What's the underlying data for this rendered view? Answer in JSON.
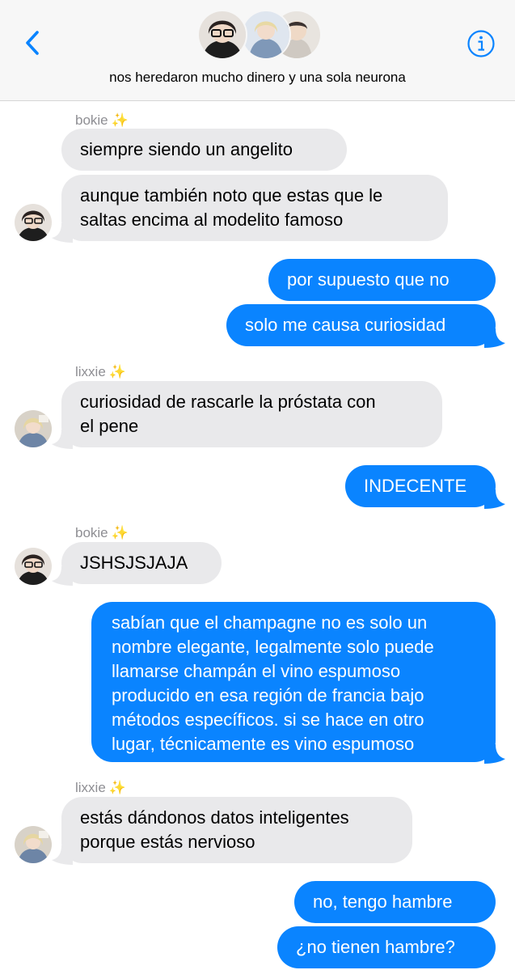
{
  "header": {
    "group_name": "nos heredaron mucho dinero y una sola neurona",
    "back_icon": "chevron-left-icon",
    "info_icon": "info-icon",
    "accent_color": "#0a84ff"
  },
  "messages": [
    {
      "sender": "bokie",
      "sparkle": "✨",
      "text": "siempre siendo un angelito",
      "direction": "incoming"
    },
    {
      "text_lines": [
        "aunque también noto que estas que le",
        "saltas encima al modelito famoso"
      ],
      "direction": "incoming"
    },
    {
      "text": "por supuesto que no",
      "direction": "outgoing"
    },
    {
      "text": "solo me causa curiosidad",
      "direction": "outgoing"
    },
    {
      "sender": "lixxie",
      "sparkle": "✨",
      "text_lines": [
        "curiosidad de rascarle la próstata con",
        "el pene"
      ],
      "direction": "incoming"
    },
    {
      "text": "INDECENTE",
      "direction": "outgoing"
    },
    {
      "sender": "bokie",
      "sparkle": "✨",
      "text": "JSHSJSJAJA",
      "direction": "incoming"
    },
    {
      "text_lines": [
        "sabían que el champagne no es solo un",
        "nombre elegante, legalmente solo puede",
        "llamarse champán el vino espumoso",
        "producido en esa región de francia bajo",
        "métodos específicos. si se hace en otro",
        "lugar, técnicamente es vino espumoso"
      ],
      "direction": "outgoing"
    },
    {
      "sender": "lixxie",
      "sparkle": "✨",
      "text_lines": [
        "estás dándonos datos inteligentes",
        "porque estás nervioso"
      ],
      "direction": "incoming"
    },
    {
      "text": "no, tengo hambre",
      "direction": "outgoing"
    },
    {
      "text": "¿no tienen hambre?",
      "direction": "outgoing"
    }
  ],
  "colors": {
    "incoming_bubble": "#e9e9eb",
    "outgoing_bubble": "#0a84ff",
    "sender_name": "#8e8e93"
  }
}
